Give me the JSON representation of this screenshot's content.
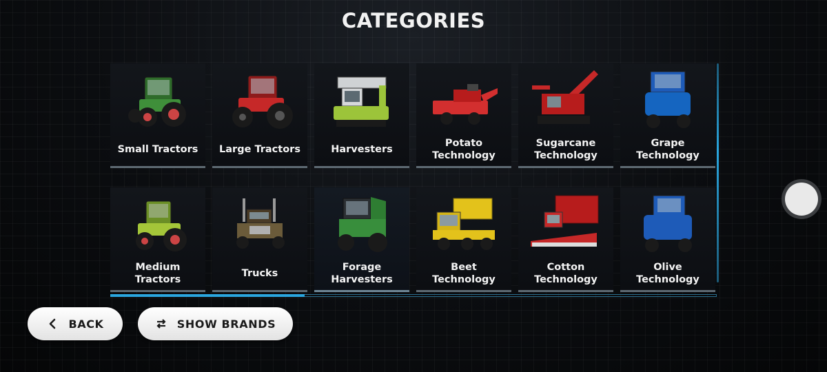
{
  "screen": {
    "title": "CATEGORIES"
  },
  "categories": [
    {
      "label": "Small Tractors",
      "icon": "small-tractor-image",
      "color": "#3f8f3a"
    },
    {
      "label": "Large Tractors",
      "icon": "large-tractor-image",
      "color": "#c62828"
    },
    {
      "label": "Harvesters",
      "icon": "harvester-image",
      "color": "#9cc43a"
    },
    {
      "label": "Potato\nTechnology",
      "icon": "potato-harvester-image",
      "color": "#d32f2f"
    },
    {
      "label": "Sugarcane\nTechnology",
      "icon": "sugarcane-harvester-image",
      "color": "#c62828"
    },
    {
      "label": "Grape\nTechnology",
      "icon": "grape-harvester-image",
      "color": "#1565c0"
    },
    {
      "label": "Medium\nTractors",
      "icon": "medium-tractor-image",
      "color": "#a4c639"
    },
    {
      "label": "Trucks",
      "icon": "truck-image",
      "color": "#6b5b3a"
    },
    {
      "label": "Forage\nHarvesters",
      "icon": "forage-harvester-image",
      "color": "#2e7d32"
    },
    {
      "label": "Beet\nTechnology",
      "icon": "beet-harvester-image",
      "color": "#e3c21b"
    },
    {
      "label": "Cotton\nTechnology",
      "icon": "cotton-picker-image",
      "color": "#b71c1c"
    },
    {
      "label": "Olive\nTechnology",
      "icon": "olive-harvester-image",
      "color": "#1e5bb8"
    }
  ],
  "buttons": {
    "back": {
      "label": "BACK",
      "icon": "chevron-left-icon"
    },
    "show_brands": {
      "label": "SHOW BRANDS",
      "icon": "swap-arrows-icon"
    }
  },
  "scrollbar": {
    "horizontal_position": 0.0,
    "visible_fraction": 0.32
  },
  "colors": {
    "accent": "#2aa6df",
    "button_bg": "#f0f0f0"
  }
}
